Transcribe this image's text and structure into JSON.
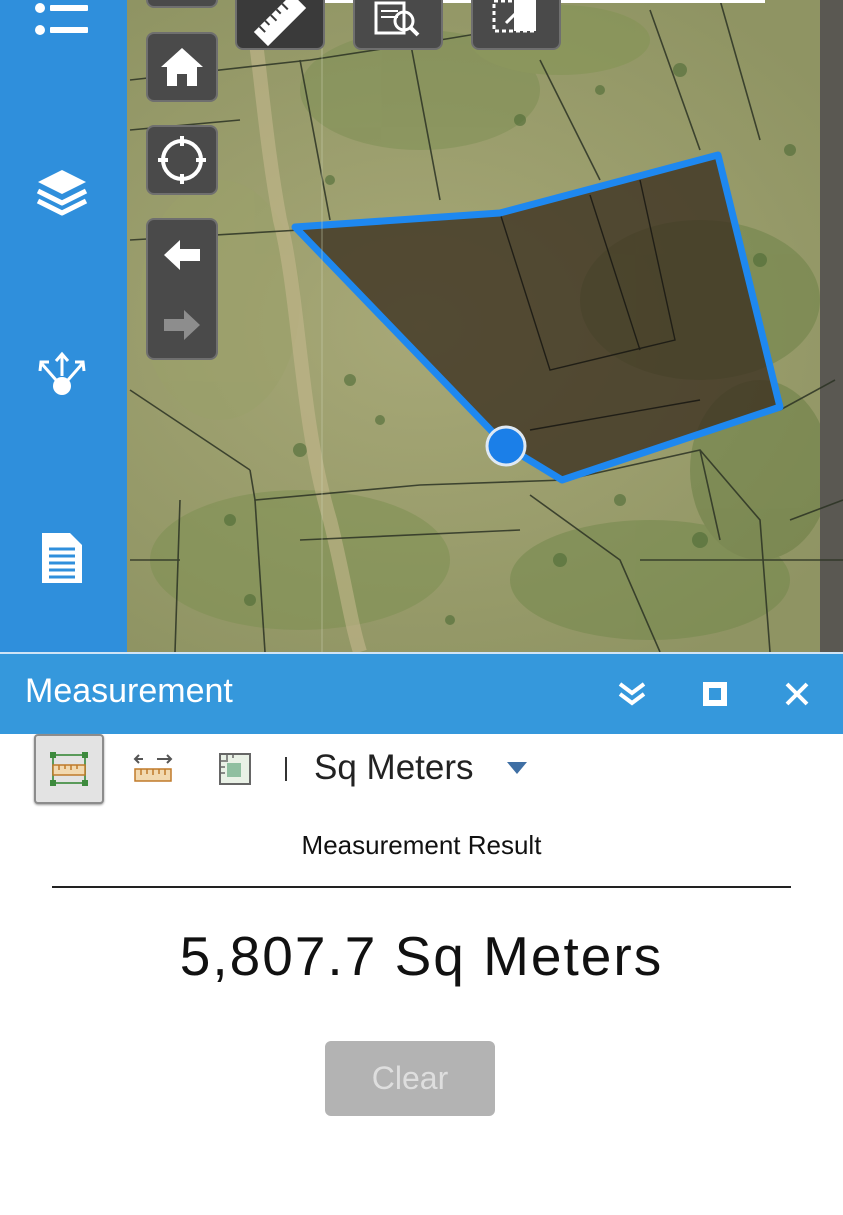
{
  "map": {
    "sidebar": {
      "items": [
        {
          "icon": "list-icon"
        },
        {
          "icon": "layers-icon"
        },
        {
          "icon": "share-icon"
        },
        {
          "icon": "document-icon"
        }
      ]
    },
    "controls": [
      "home-icon",
      "locate-icon",
      "back-arrow-icon",
      "forward-arrow-icon"
    ],
    "top_tools": [
      "measure-ruler-icon",
      "query-icon",
      "swipe-icon"
    ]
  },
  "panel": {
    "title": "Measurement",
    "header_buttons": [
      "collapse-icon",
      "maximize-icon",
      "close-icon"
    ],
    "toolbar": {
      "tools": [
        "area-tool",
        "distance-tool",
        "location-tool"
      ],
      "active_tool": "area-tool",
      "separator": "|",
      "unit": "Sq Meters"
    },
    "result_label": "Measurement Result",
    "result_value": "5,807.7 Sq Meters",
    "clear_label": "Clear"
  },
  "colors": {
    "sidebar": "#2f8fdc",
    "header": "#3598dc",
    "polygon_outline": "#1e88f0",
    "polygon_fill": "#3b2f20"
  }
}
